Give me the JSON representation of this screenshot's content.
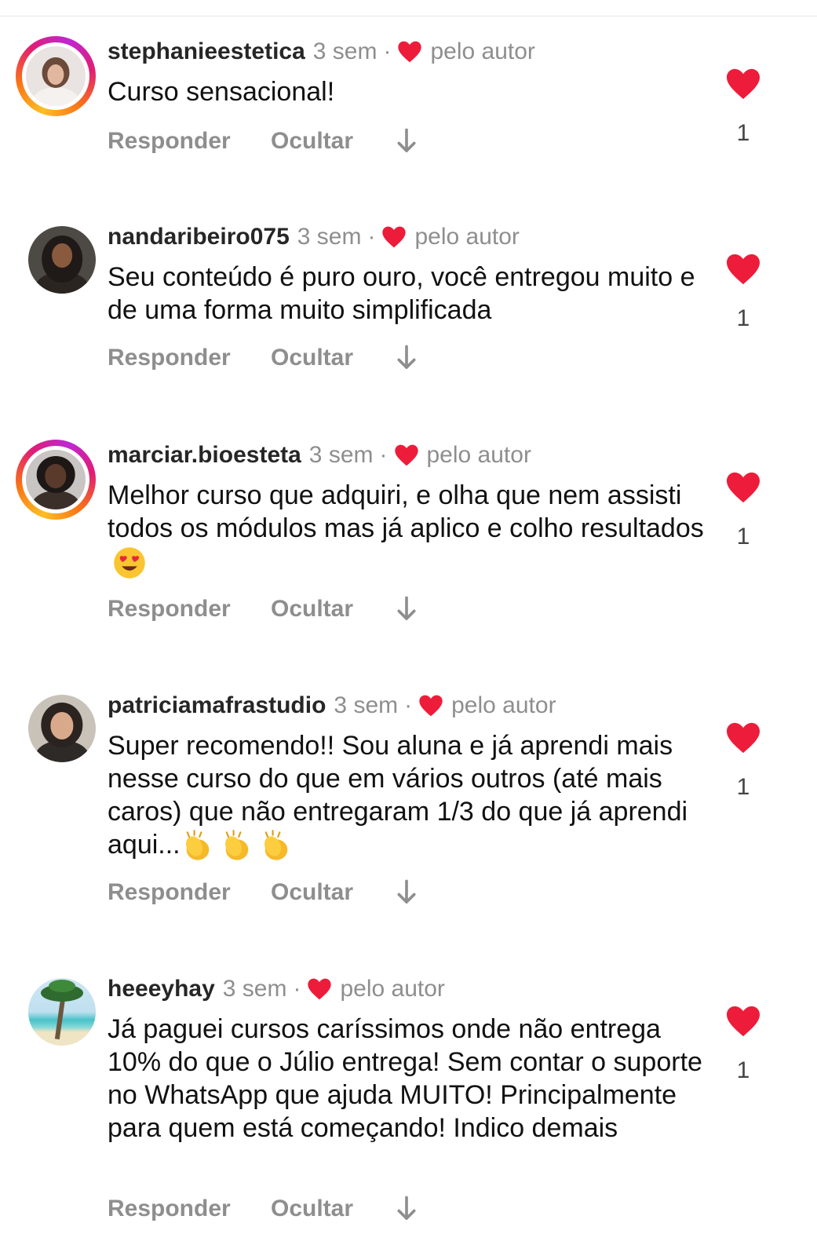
{
  "colors": {
    "heart": "#ed1c3a",
    "meta_gray": "#8e8e8e",
    "username": "#262626"
  },
  "comments": [
    {
      "username": "stephanieestetica",
      "time": "3 sem",
      "separator": "·",
      "author_like_label": "pelo autor",
      "text": "Curso sensacional!",
      "reply_label": "Responder",
      "hide_label": "Ocultar",
      "like_count": "1",
      "has_story_ring": true
    },
    {
      "username": "nandaribeiro075",
      "time": "3 sem",
      "separator": "·",
      "author_like_label": "pelo autor",
      "text": "Seu conteúdo é puro ouro, você entregou muito e de uma forma muito simplificada",
      "reply_label": "Responder",
      "hide_label": "Ocultar",
      "like_count": "1",
      "has_story_ring": false
    },
    {
      "username": "marciar.bioesteta",
      "time": "3 sem",
      "separator": "·",
      "author_like_label": "pelo autor",
      "text": "Melhor curso que adquiri, e olha que nem assisti todos os módulos mas já aplico e colho resultados",
      "text_emoji": "heart-eyes-emoji",
      "reply_label": "Responder",
      "hide_label": "Ocultar",
      "like_count": "1",
      "has_story_ring": true
    },
    {
      "username": "patriciamafrastudio",
      "time": "3 sem",
      "separator": "·",
      "author_like_label": "pelo autor",
      "text": "Super recomendo!! Sou aluna e já aprendi mais nesse curso do que em vários outros (até mais caros) que não entregaram 1/3 do que já aprendi aqui...",
      "text_emoji": "clapping-hands-emoji x3",
      "reply_label": "Responder",
      "hide_label": "Ocultar",
      "like_count": "1",
      "has_story_ring": false
    },
    {
      "username": "heeeyhay",
      "time": "3 sem",
      "separator": "·",
      "author_like_label": "pelo autor",
      "text": "Já paguei cursos caríssimos onde não entrega 10% do que o Júlio entrega! Sem contar o suporte no WhatsApp que ajuda MUITO! Principalmente para quem está começando! Indico demais",
      "reply_label": "Responder",
      "hide_label": "Ocultar",
      "like_count": "1",
      "has_story_ring": false
    }
  ]
}
